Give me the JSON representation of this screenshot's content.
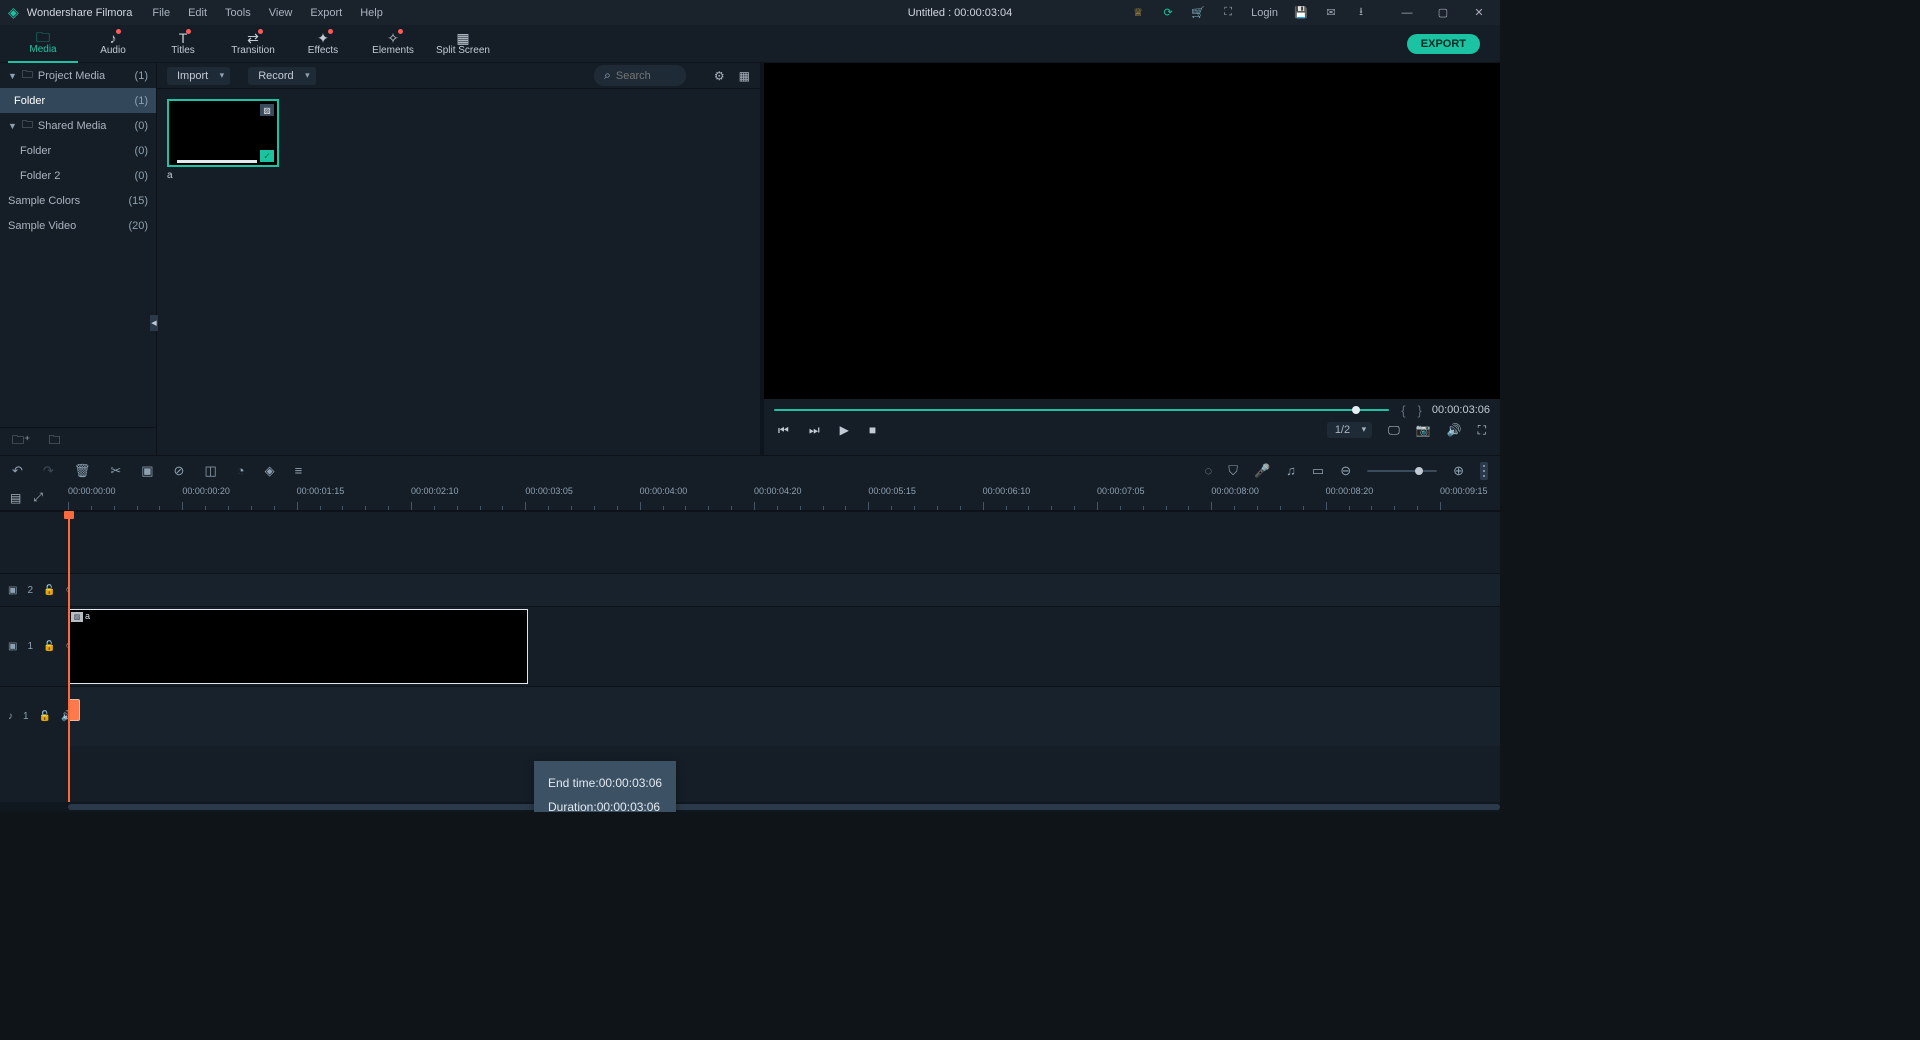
{
  "app": {
    "name": "Wondershare Filmora",
    "title_center": "Untitled : 00:00:03:04",
    "login": "Login"
  },
  "menu": [
    "File",
    "Edit",
    "Tools",
    "View",
    "Export",
    "Help"
  ],
  "tabs": [
    {
      "label": "Media",
      "active": true
    },
    {
      "label": "Audio",
      "dot": true
    },
    {
      "label": "Titles",
      "dot": true
    },
    {
      "label": "Transition",
      "dot": true
    },
    {
      "label": "Effects",
      "dot": true
    },
    {
      "label": "Elements",
      "dot": true
    },
    {
      "label": "Split Screen"
    }
  ],
  "export_label": "EXPORT",
  "tree": [
    {
      "label": "Project Media",
      "count": "(1)",
      "parent": true,
      "icon": "folder"
    },
    {
      "label": "Folder",
      "count": "(1)",
      "selected": true
    },
    {
      "label": "Shared Media",
      "count": "(0)",
      "parent": true,
      "icon": "folder"
    },
    {
      "label": "Folder",
      "count": "(0)"
    },
    {
      "label": "Folder 2",
      "count": "(0)"
    },
    {
      "label": "Sample Colors",
      "count": "(15)",
      "top": true
    },
    {
      "label": "Sample Video",
      "count": "(20)",
      "top": true
    }
  ],
  "cp": {
    "import": "Import",
    "record": "Record",
    "search_ph": "Search"
  },
  "clip": {
    "name": "a"
  },
  "preview": {
    "time": "00:00:03:06",
    "scale": "1/2"
  },
  "ruler": [
    "00:00:00:00",
    "00:00:00:20",
    "00:00:01:15",
    "00:00:02:10",
    "00:00:03:05",
    "00:00:04:00",
    "00:00:04:20",
    "00:00:05:15",
    "00:00:06:10",
    "00:00:07:05",
    "00:00:08:00",
    "00:00:08:20",
    "00:00:09:15"
  ],
  "tracks": {
    "vid2": "2",
    "vid1": "1",
    "aud1": "1"
  },
  "clip_on_track": {
    "name": "a"
  },
  "tooltip": {
    "l1a": "End time:",
    "l1b": "00:00:03:06",
    "l2a": "Duration:",
    "l2b": "00:00:03:06"
  }
}
